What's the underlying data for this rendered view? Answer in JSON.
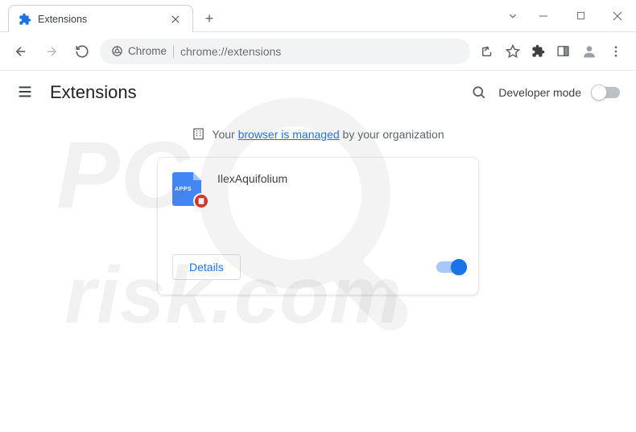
{
  "tab": {
    "title": "Extensions"
  },
  "omnibox": {
    "scheme_label": "Chrome",
    "url": "chrome://extensions"
  },
  "page": {
    "title": "Extensions",
    "developer_mode_label": "Developer mode",
    "developer_mode_on": false
  },
  "managed_notice": {
    "prefix": "Your ",
    "link": "browser is managed",
    "suffix": " by your organization"
  },
  "extension": {
    "name": "IlexAquifolium",
    "icon_text": "APPS",
    "details_label": "Details",
    "enabled": true
  },
  "watermark": {
    "text": "risk.com"
  }
}
